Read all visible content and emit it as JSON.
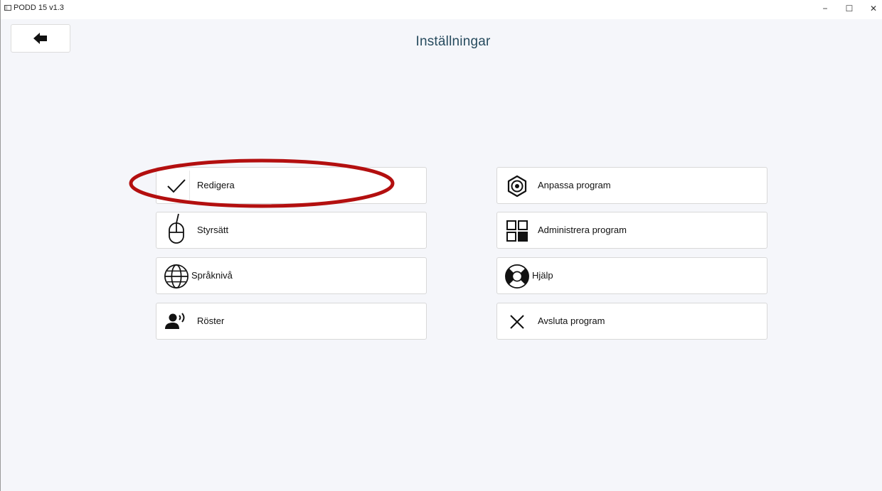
{
  "window": {
    "title": "PODD 15 v1.3",
    "controls": {
      "minimize": "−",
      "maximize": "☐",
      "close": "✕"
    }
  },
  "header": {
    "back_icon": "arrow-left-icon",
    "title": "Inställningar"
  },
  "menu": {
    "left": [
      {
        "id": "redigera",
        "label": "Redigera",
        "icon": "checkmark-icon"
      },
      {
        "id": "styrsatt",
        "label": "Styrsätt",
        "icon": "mouse-icon"
      },
      {
        "id": "sprakniva",
        "label": "Språknivå",
        "icon": "globe-icon"
      },
      {
        "id": "roster",
        "label": "Röster",
        "icon": "speaking-person-icon"
      }
    ],
    "right": [
      {
        "id": "anpassa",
        "label": "Anpassa program",
        "icon": "gear-icon"
      },
      {
        "id": "administrera",
        "label": "Administrera program",
        "icon": "grid-icon"
      },
      {
        "id": "hjalp",
        "label": "Hjälp",
        "icon": "lifebuoy-icon"
      },
      {
        "id": "avsluta",
        "label": "Avsluta program",
        "icon": "close-icon"
      }
    ]
  },
  "annotation": {
    "highlight_color": "#b30f0f",
    "target": "redigera"
  },
  "colors": {
    "title": "#274b5e",
    "background": "#f5f6fa"
  }
}
